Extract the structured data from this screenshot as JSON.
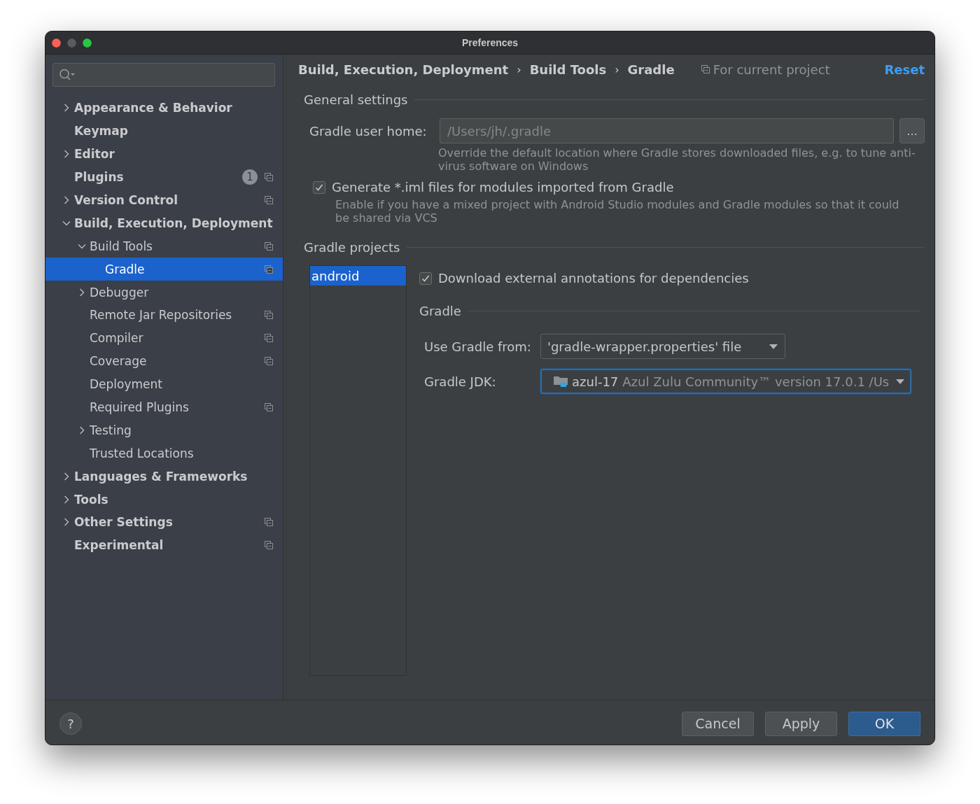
{
  "window": {
    "title": "Preferences"
  },
  "sidebar": {
    "items": [
      {
        "label": "Appearance & Behavior",
        "expanded": false,
        "selected": false,
        "project_scoped": false
      },
      {
        "label": "Keymap",
        "selected": false,
        "project_scoped": false
      },
      {
        "label": "Editor",
        "expanded": false,
        "selected": false,
        "project_scoped": false
      },
      {
        "label": "Plugins",
        "selected": false,
        "project_scoped": true,
        "badge": "1"
      },
      {
        "label": "Version Control",
        "expanded": false,
        "selected": false,
        "project_scoped": true
      },
      {
        "label": "Build, Execution, Deployment",
        "expanded": true,
        "selected": false,
        "project_scoped": false,
        "children": [
          {
            "label": "Build Tools",
            "expanded": true,
            "selected": false,
            "project_scoped": true,
            "children": [
              {
                "label": "Gradle",
                "selected": true,
                "project_scoped": true
              }
            ]
          },
          {
            "label": "Debugger",
            "expanded": false,
            "selected": false,
            "project_scoped": false
          },
          {
            "label": "Remote Jar Repositories",
            "selected": false,
            "project_scoped": true
          },
          {
            "label": "Compiler",
            "selected": false,
            "project_scoped": true
          },
          {
            "label": "Coverage",
            "selected": false,
            "project_scoped": true
          },
          {
            "label": "Deployment",
            "selected": false,
            "project_scoped": false
          },
          {
            "label": "Required Plugins",
            "selected": false,
            "project_scoped": true
          },
          {
            "label": "Testing",
            "expanded": false,
            "selected": false,
            "project_scoped": false
          },
          {
            "label": "Trusted Locations",
            "selected": false,
            "project_scoped": false
          }
        ]
      },
      {
        "label": "Languages & Frameworks",
        "expanded": false,
        "selected": false,
        "project_scoped": false
      },
      {
        "label": "Tools",
        "expanded": false,
        "selected": false,
        "project_scoped": false
      },
      {
        "label": "Other Settings",
        "expanded": false,
        "selected": false,
        "project_scoped": true
      },
      {
        "label": "Experimental",
        "selected": false,
        "project_scoped": true
      }
    ]
  },
  "header": {
    "breadcrumb": [
      "Build, Execution, Deployment",
      "Build Tools",
      "Gradle"
    ],
    "separator": "›",
    "scope": "For current project",
    "reset": "Reset"
  },
  "general_settings": {
    "title": "General settings",
    "user_home": {
      "label": "Gradle user home:",
      "placeholder": "/Users/jh/.gradle",
      "browse": "...",
      "hint": "Override the default location where Gradle stores downloaded files, e.g. to tune anti-virus software on Windows"
    },
    "generate_iml": {
      "label": "Generate *.iml files for modules imported from Gradle",
      "checked": true,
      "hint": "Enable if you have a mixed project with Android Studio modules and Gradle modules so that it could be shared via VCS"
    }
  },
  "gradle_projects": {
    "title": "Gradle projects",
    "projects": [
      {
        "name": "android",
        "selected": true
      }
    ],
    "download_annotations": {
      "label": "Download external annotations for dependencies",
      "checked": true
    },
    "gradle": {
      "title": "Gradle",
      "use_from": {
        "label": "Use Gradle from:",
        "value": "'gradle-wrapper.properties' file"
      },
      "jdk": {
        "label": "Gradle JDK:",
        "name": "azul-17",
        "detail": "Azul Zulu Community™ version 17.0.1 /Us",
        "focused": true
      }
    }
  },
  "footer": {
    "help": "?",
    "buttons": [
      {
        "label": "Cancel",
        "kind": "default"
      },
      {
        "label": "Apply",
        "kind": "default"
      },
      {
        "label": "OK",
        "kind": "primary"
      }
    ]
  }
}
